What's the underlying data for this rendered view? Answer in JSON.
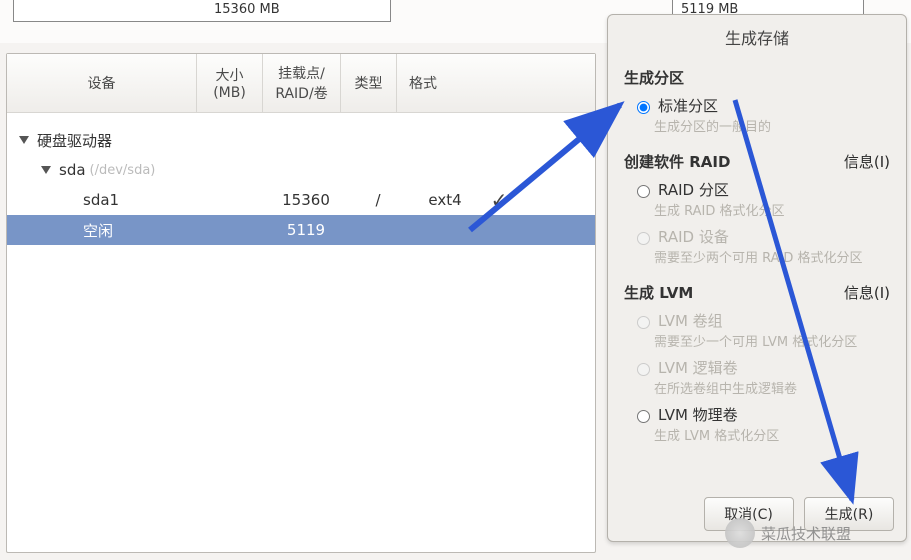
{
  "top": {
    "left_box_mb": "15360 MB",
    "right_box_mb": "5119 MB"
  },
  "table": {
    "headers": {
      "device": "设备",
      "size": "大小\n(MB)",
      "mount": "挂载点/\nRAID/卷",
      "type": "类型",
      "format": "格式"
    },
    "rows": {
      "hdd_group": "硬盘驱动器",
      "sda_label": "sda",
      "sda_path": "(/dev/sda)",
      "sda1_label": "sda1",
      "sda1_size": "15360",
      "sda1_mount": "/",
      "sda1_type": "ext4",
      "sda1_format": "✓",
      "free_label": "空闲",
      "free_size": "5119"
    }
  },
  "dialog": {
    "title": "生成存储",
    "section_partition": "生成分区",
    "opt_standard": "标准分区",
    "opt_standard_desc": "生成分区的一般目的",
    "section_raid": "创建软件 RAID",
    "info": "信息(I)",
    "opt_raid_part": "RAID 分区",
    "opt_raid_part_desc": "生成 RAID 格式化分区",
    "opt_raid_dev": "RAID 设备",
    "opt_raid_dev_desc": "需要至少两个可用 RAID 格式化分区",
    "section_lvm": "生成 LVM",
    "opt_lvm_vg": "LVM 卷组",
    "opt_lvm_vg_desc": "需要至少一个可用 LVM 格式化分区",
    "opt_lvm_lv": "LVM 逻辑卷",
    "opt_lvm_lv_desc": "在所选卷组中生成逻辑卷",
    "opt_lvm_pv": "LVM 物理卷",
    "opt_lvm_pv_desc": "生成 LVM 格式化分区",
    "btn_cancel": "取消(C)",
    "btn_create": "生成(R)"
  },
  "watermark": "菜瓜技术联盟"
}
